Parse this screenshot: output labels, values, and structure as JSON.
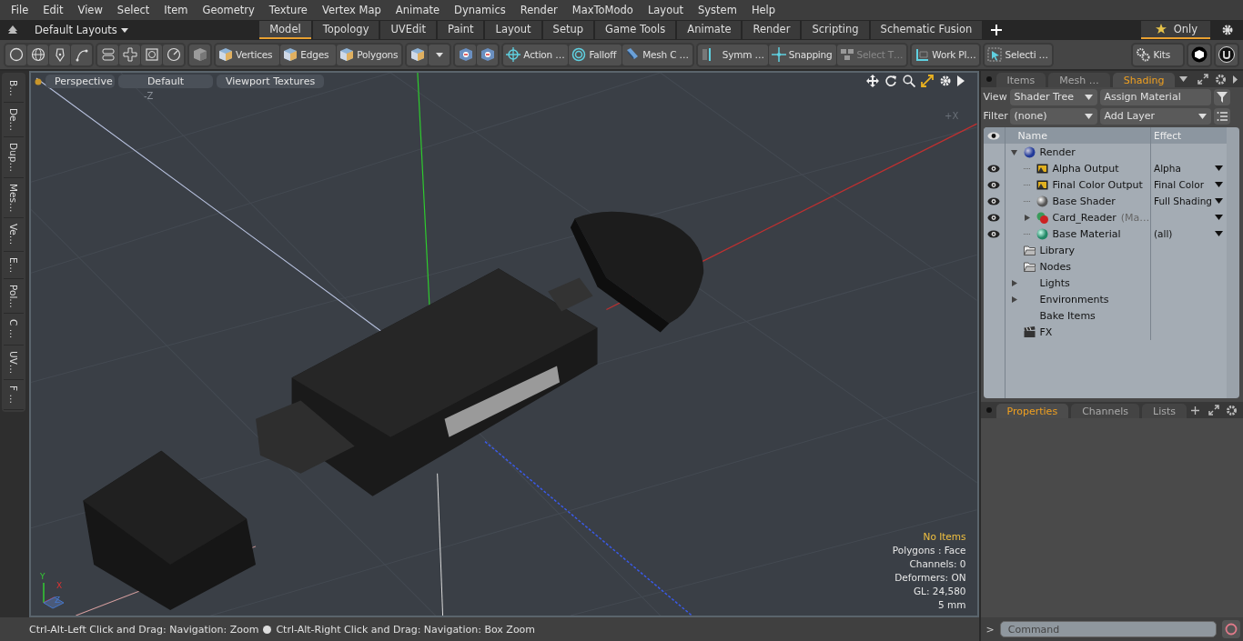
{
  "menu": [
    "File",
    "Edit",
    "View",
    "Select",
    "Item",
    "Geometry",
    "Texture",
    "Vertex Map",
    "Animate",
    "Dynamics",
    "Render",
    "MaxToModo",
    "Layout",
    "System",
    "Help"
  ],
  "layouts": {
    "label": "Default Layouts",
    "tabs": [
      {
        "label": "Model",
        "selected": true
      },
      {
        "label": "Topology",
        "selected": false
      },
      {
        "label": "UVEdit",
        "selected": false
      },
      {
        "label": "Paint",
        "selected": false
      },
      {
        "label": "Layout",
        "selected": false
      },
      {
        "label": "Setup",
        "selected": false
      },
      {
        "label": "Game Tools",
        "selected": false
      },
      {
        "label": "Animate",
        "selected": false
      },
      {
        "label": "Render",
        "selected": false
      },
      {
        "label": "Scripting",
        "selected": false
      },
      {
        "label": "Schematic Fusion",
        "selected": false
      }
    ],
    "only": {
      "label": "Only",
      "selected": true
    }
  },
  "toolbar": [
    {
      "label": "Vertices",
      "disabled": false
    },
    {
      "label": "Edges",
      "disabled": false
    },
    {
      "label": "Polygons",
      "disabled": false
    },
    {
      "label": "Action …",
      "disabled": false
    },
    {
      "label": "Falloff",
      "disabled": false
    },
    {
      "label": "Mesh C …",
      "disabled": false
    },
    {
      "label": "Symm …",
      "disabled": false
    },
    {
      "label": "Snapping",
      "disabled": false
    },
    {
      "label": "Select T…",
      "disabled": true
    },
    {
      "label": "Work Pl…",
      "disabled": false
    },
    {
      "label": "Selecti …",
      "disabled": false
    },
    {
      "label": "Kits",
      "disabled": false
    }
  ],
  "side_tabs": [
    "B…",
    "De…",
    "Dup…",
    "Mes…",
    "Ve…",
    "E…",
    "Pol…",
    "C …",
    "UV…",
    "F …"
  ],
  "viewport": {
    "buttons": [
      "Perspective",
      "Default",
      "Viewport Textures"
    ],
    "axis_labels": [
      "-Z",
      "+X"
    ],
    "info": [
      {
        "text": "No Items",
        "highlight": true
      },
      {
        "text": "Polygons : Face",
        "highlight": false
      },
      {
        "text": "Channels: 0",
        "highlight": false
      },
      {
        "text": "Deformers: ON",
        "highlight": false
      },
      {
        "text": "GL: 24,580",
        "highlight": false
      },
      {
        "text": "5 mm",
        "highlight": false
      }
    ],
    "gizmo": [
      "Y",
      "X",
      "Z"
    ]
  },
  "status_bar": [
    "Ctrl-Alt-Left Click and Drag: Navigation: Zoom",
    "Ctrl-Alt-Right Click and Drag: Navigation: Box Zoom"
  ],
  "shading_panel": {
    "tabs": [
      {
        "label": "Items",
        "selected": false
      },
      {
        "label": "Mesh …",
        "selected": false
      },
      {
        "label": "Shading",
        "selected": true
      }
    ],
    "view_label": "View",
    "view_value": "Shader Tree",
    "assign": "Assign Material",
    "filter_label": "Filter",
    "filter_value": "(none)",
    "add_layer": "Add Layer",
    "columns": [
      "Name",
      "Effect"
    ],
    "tree": [
      {
        "name": "Render",
        "kind": "render",
        "visible": false,
        "expanded": true,
        "children": [
          {
            "name": "Alpha Output",
            "kind": "output",
            "visible": true,
            "effect": "Alpha"
          },
          {
            "name": "Final Color Output",
            "kind": "output",
            "visible": true,
            "effect": "Final Color"
          },
          {
            "name": "Base Shader",
            "kind": "shader",
            "visible": true,
            "effect": "Full Shading"
          },
          {
            "name": "Card_Reader",
            "suffix": "(Ma…",
            "kind": "group",
            "visible": true,
            "expanded": false
          },
          {
            "name": "Base Material",
            "kind": "material",
            "visible": true,
            "effect": "(all)"
          }
        ]
      },
      {
        "name": "Library",
        "kind": "folder",
        "visible": false
      },
      {
        "name": "Nodes",
        "kind": "folder",
        "visible": false
      },
      {
        "name": "Lights",
        "visible": false,
        "expanded": false
      },
      {
        "name": "Environments",
        "visible": false,
        "expanded": false
      },
      {
        "name": "Bake Items",
        "visible": false
      },
      {
        "name": "FX",
        "kind": "fx",
        "visible": false
      }
    ]
  },
  "properties_panel": {
    "tabs": [
      {
        "label": "Properties",
        "selected": true
      },
      {
        "label": "Channels",
        "selected": false
      },
      {
        "label": "Lists",
        "selected": false
      }
    ]
  },
  "command": {
    "prompt": ">",
    "placeholder": "Command"
  }
}
